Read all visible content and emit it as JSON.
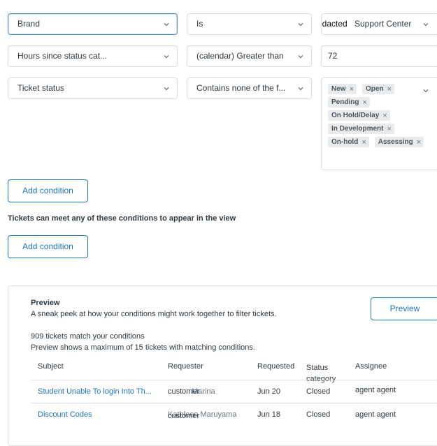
{
  "conditions_all": [
    {
      "field": "Brand",
      "operator": "Is",
      "value": "Support Center",
      "value_prefix": "redacted"
    },
    {
      "field": "Hours since status cat...",
      "operator": "(calendar) Greater than",
      "value": "72"
    },
    {
      "field": "Ticket status",
      "operator": "Contains none of the f...",
      "tags": [
        "New",
        "Open",
        "Pending",
        "On Hold/Delay",
        "In Development",
        "On-hold",
        "Assessing"
      ]
    }
  ],
  "add_condition_label": "Add condition",
  "any_heading": "Tickets can meet any of these conditions to appear in the view",
  "preview": {
    "title": "Preview",
    "subtitle": "A sneak peek at how your conditions might work together to filter tickets.",
    "button_label": "Preview",
    "match_count": "909 tickets match your conditions",
    "max_note": "Preview shows a maximum of 15 tickets with matching conditions.",
    "columns": [
      "Subject",
      "Requester",
      "Requested",
      "Status category",
      "Assignee"
    ],
    "rows": [
      {
        "subject": "Student Unable To login Into Th...",
        "requester": "customer",
        "requester_overlap": "Marina",
        "requested": "Jun 20",
        "status": "Closed",
        "assignee": "agent agent"
      },
      {
        "subject": "Discount Codes",
        "requester": "customer",
        "requester_overlap": "Kathleen Maruyama",
        "requested": "Jun 18",
        "status": "Closed",
        "assignee": "agent agent"
      }
    ]
  }
}
